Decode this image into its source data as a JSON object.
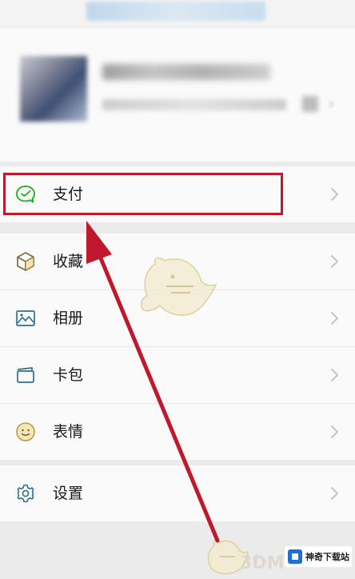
{
  "menu": {
    "pay_label": "支付",
    "favorites_label": "收藏",
    "album_label": "相册",
    "cards_label": "卡包",
    "stickers_label": "表情",
    "settings_label": "设置"
  },
  "watermark": {
    "text": "3DM",
    "brand_name": "神奇下载站"
  },
  "colors": {
    "icon_accent": "#1aad19",
    "highlight": "#c0182c",
    "arrow": "#c0182c"
  }
}
